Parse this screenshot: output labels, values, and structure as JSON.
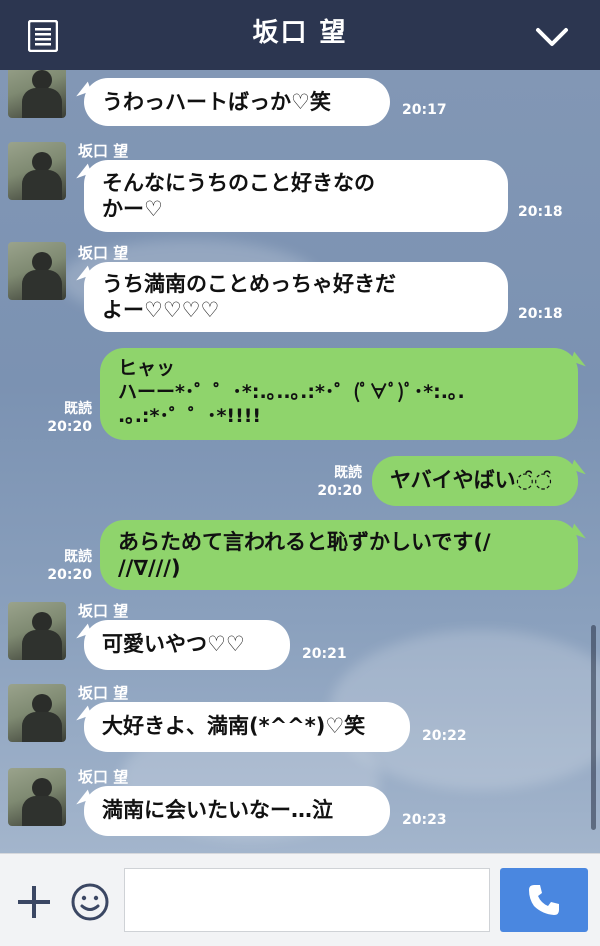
{
  "header": {
    "title": "坂口 望"
  },
  "messages": [
    {
      "sender": "",
      "text": "うわっハートばっか♡笑",
      "time": "20:17"
    },
    {
      "sender": "坂口 望",
      "text": "そんなにうちのこと好きなの\nかー♡",
      "time": "20:18"
    },
    {
      "sender": "坂口 望",
      "text": "うち満南のことめっちゃ好きだ\nよー♡♡♡♡",
      "time": "20:18"
    },
    {
      "read": "既読",
      "text": "ヒャッ\nハーー*･゜゜･*:.｡..｡.:*･゜(ﾟ∀ﾟ)ﾟ･*:.｡.\n.｡.:*･゜゜･*!!!!",
      "time": "20:20"
    },
    {
      "read": "既読",
      "text": "ヤバイやばい◌̑◌̑",
      "time": "20:20"
    },
    {
      "read": "既読",
      "text": "あらためて言われると恥ずかしいです(/\n//∇///)",
      "time": "20:20"
    },
    {
      "sender": "坂口 望",
      "text": "可愛いやつ♡♡",
      "time": "20:21"
    },
    {
      "sender": "坂口 望",
      "text": "大好きよ、満南(*^^*)♡笑",
      "time": "20:22"
    },
    {
      "sender": "坂口 望",
      "text": "満南に会いたいなー…泣",
      "time": "20:23"
    }
  ],
  "footer": {
    "input_value": ""
  },
  "colors": {
    "header": "#2c3650",
    "outgoing_bubble": "#8fd46c",
    "incoming_bubble": "#ffffff",
    "call_button": "#4a87e0"
  },
  "icons": [
    "menu-icon",
    "chevron-down-icon",
    "plus-icon",
    "smile-icon",
    "phone-icon"
  ]
}
